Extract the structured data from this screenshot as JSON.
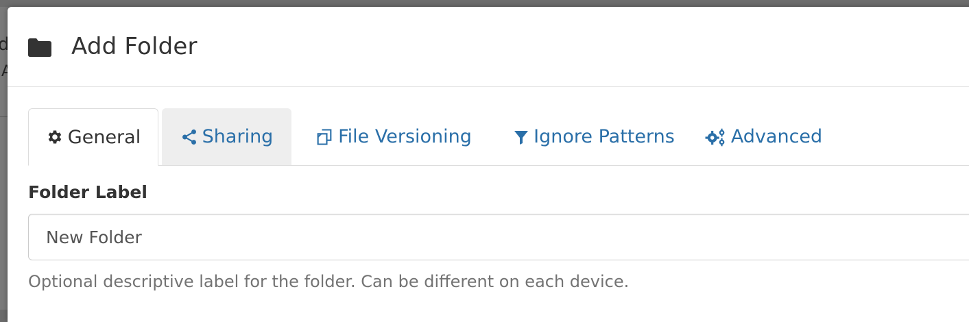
{
  "background": {
    "fragment_1": "d",
    "fragment_2": "A"
  },
  "modal": {
    "title": "Add Folder",
    "icon": "folder-icon"
  },
  "tabs": [
    {
      "label": "General",
      "icon": "gear-icon",
      "state": "active"
    },
    {
      "label": "Sharing",
      "icon": "share-icon",
      "state": "hover"
    },
    {
      "label": "File Versioning",
      "icon": "copy-icon",
      "state": "default"
    },
    {
      "label": "Ignore Patterns",
      "icon": "filter-icon",
      "state": "default"
    },
    {
      "label": "Advanced",
      "icon": "gears-icon",
      "state": "default"
    }
  ],
  "form": {
    "folder_label": {
      "label": "Folder Label",
      "value": "New Folder",
      "help": "Optional descriptive label for the folder. Can be different on each device."
    }
  },
  "colors": {
    "link": "#2a6fa8",
    "text": "#333333",
    "help": "#737373",
    "tab_hover_bg": "#eeeeee"
  }
}
